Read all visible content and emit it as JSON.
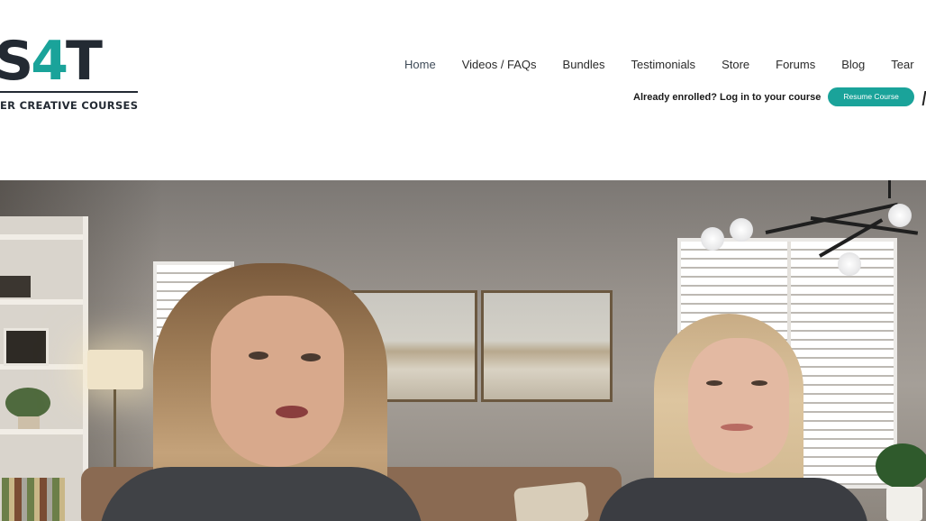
{
  "header": {
    "logo": {
      "mark_main": "S",
      "mark_accent": "4",
      "mark_end": "T",
      "tagline": "ER CREATIVE COURSES"
    },
    "nav": {
      "items": [
        {
          "label": "Home",
          "active": true
        },
        {
          "label": "Videos / FAQs"
        },
        {
          "label": "Bundles"
        },
        {
          "label": "Testimonials"
        },
        {
          "label": "Store"
        },
        {
          "label": "Forums"
        },
        {
          "label": "Blog"
        },
        {
          "label": "Tear"
        }
      ]
    },
    "enroll": {
      "text": "Already enrolled? Log in to your course",
      "button_label": "Resume Course"
    }
  },
  "hero": {
    "description_icon": "video-hero-image"
  },
  "colors": {
    "accent": "#1aa39a",
    "logo_dark": "#232a33",
    "nav_text": "#2a2a2a"
  }
}
